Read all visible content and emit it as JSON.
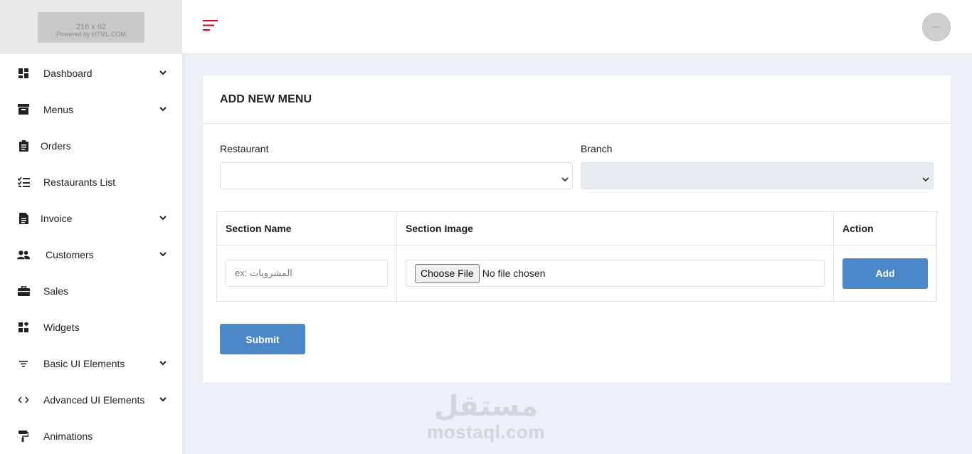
{
  "logo": {
    "line1": "216 x 62",
    "line2": "Powered by HTML.COM"
  },
  "sidebar": {
    "items": [
      {
        "label": "Dashboard",
        "icon": "dashboard-icon",
        "has_submenu": true
      },
      {
        "label": "Menus",
        "icon": "archive-icon",
        "has_submenu": true
      },
      {
        "label": "Orders",
        "icon": "clipboard-icon",
        "has_submenu": false
      },
      {
        "label": "Restaurants List",
        "icon": "checklist-icon",
        "has_submenu": false
      },
      {
        "label": "Invoice",
        "icon": "document-icon",
        "has_submenu": true
      },
      {
        "label": "Customers",
        "icon": "users-icon",
        "has_submenu": true
      },
      {
        "label": "Sales",
        "icon": "briefcase-icon",
        "has_submenu": false
      },
      {
        "label": "Widgets",
        "icon": "widgets-icon",
        "has_submenu": false
      },
      {
        "label": "Basic UI Elements",
        "icon": "filter-icon",
        "has_submenu": true
      },
      {
        "label": "Advanced UI Elements",
        "icon": "code-icon",
        "has_submenu": true
      },
      {
        "label": "Animations",
        "icon": "paint-roller-icon",
        "has_submenu": false
      }
    ]
  },
  "topbar": {
    "menu_icon": "hamburger-icon",
    "accent_color": "#c8102e"
  },
  "card": {
    "title": "ADD NEW MENU",
    "restaurant_label": "Restaurant",
    "restaurant_value": "",
    "branch_label": "Branch",
    "branch_value": "",
    "table": {
      "headers": [
        "Section Name",
        "Section Image",
        "Action"
      ],
      "row": {
        "name_placeholder": "ex: المشروبات",
        "file_button": "Choose File",
        "file_status": "No file chosen",
        "action_label": "Add"
      }
    },
    "submit_label": "Submit"
  },
  "colors": {
    "primary": "#4a88c8",
    "background": "#eef0f8"
  },
  "watermark": {
    "arabic": "مستقل",
    "latin": "mostaql.com"
  }
}
